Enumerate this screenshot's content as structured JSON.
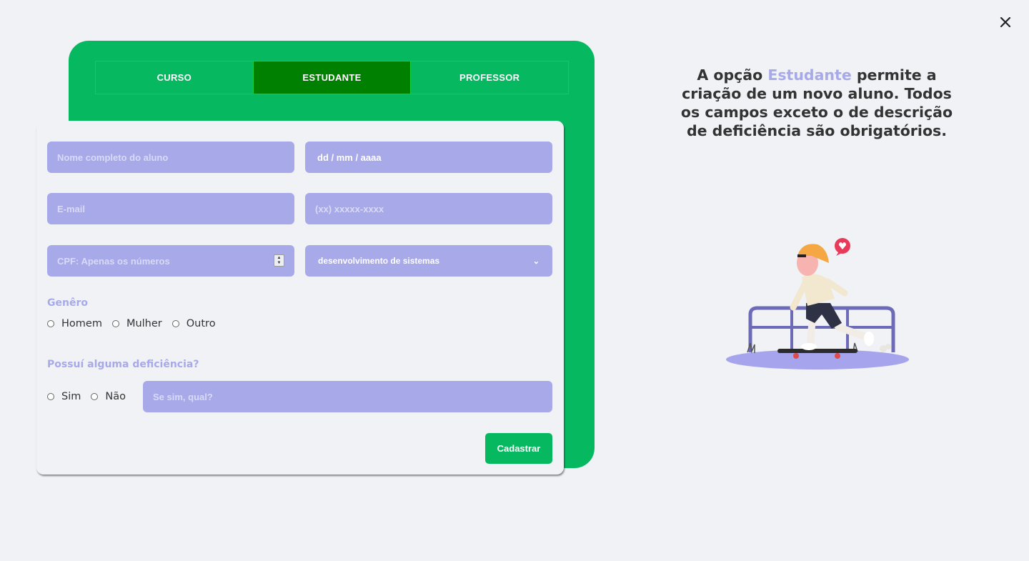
{
  "colors": {
    "brand_green": "#06b960",
    "active_tab": "#008000",
    "field_bg": "#a8a9e9",
    "accent": "#a8a9e9",
    "text": "#333333"
  },
  "header": {
    "close_icon": "close-icon"
  },
  "tabs": [
    {
      "label": "CURSO",
      "active": false
    },
    {
      "label": "ESTUDANTE",
      "active": true
    },
    {
      "label": "PROFESSOR",
      "active": false
    }
  ],
  "form": {
    "name_placeholder": "Nome completo do aluno",
    "birth_placeholder": "dd / mm / aaaa",
    "email_placeholder": "E-mail",
    "phone_placeholder": "(xx) xxxxx-xxxx",
    "cpf_placeholder": "CPF: Apenas os números",
    "course_selected": "desenvolvimento de sistemas",
    "gender_label": "Genêro",
    "gender_options": [
      "Homem",
      "Mulher",
      "Outro"
    ],
    "disability_label": "Possuí alguma deficiência?",
    "disability_options": [
      "Sim",
      "Não"
    ],
    "disability_placeholder": "Se sim, qual?",
    "submit_label": "Cadastrar"
  },
  "info": {
    "part1": "A opção ",
    "highlight": "Estudante",
    "part2": " permite a criação de um novo aluno. Todos os campos exceto o de descrição de deficiência são obrigatórios."
  }
}
